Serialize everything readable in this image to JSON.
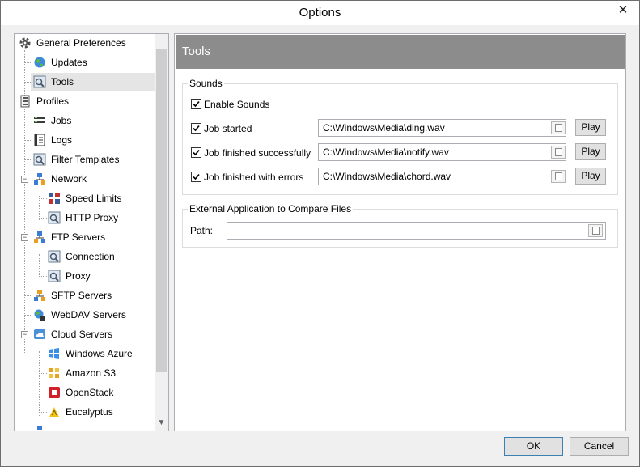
{
  "window": {
    "title": "Options",
    "close_glyph": "✕"
  },
  "tree": {
    "items": [
      {
        "label": "General Preferences",
        "icon": "gear-icon"
      },
      {
        "label": "Updates",
        "icon": "globe-icon"
      },
      {
        "label": "Tools",
        "icon": "tools-icon"
      },
      {
        "label": "Profiles",
        "icon": "profiles-icon"
      },
      {
        "label": "Jobs",
        "icon": "jobs-icon"
      },
      {
        "label": "Logs",
        "icon": "logs-icon"
      },
      {
        "label": "Filter Templates",
        "icon": "filter-icon"
      },
      {
        "label": "Network",
        "icon": "network-icon"
      },
      {
        "label": "Speed Limits",
        "icon": "speed-icon"
      },
      {
        "label": "HTTP Proxy",
        "icon": "proxy-icon"
      },
      {
        "label": "FTP Servers",
        "icon": "ftp-icon"
      },
      {
        "label": "Connection",
        "icon": "connection-icon"
      },
      {
        "label": "Proxy",
        "icon": "proxy-icon"
      },
      {
        "label": "SFTP Servers",
        "icon": "sftp-icon"
      },
      {
        "label": "WebDAV Servers",
        "icon": "webdav-icon"
      },
      {
        "label": "Cloud Servers",
        "icon": "cloud-icon"
      },
      {
        "label": "Windows Azure",
        "icon": "azure-icon"
      },
      {
        "label": "Amazon S3",
        "icon": "amazon-icon"
      },
      {
        "label": "OpenStack",
        "icon": "openstack-icon"
      },
      {
        "label": "Eucalyptus",
        "icon": "eucalyptus-icon"
      }
    ],
    "collapse_glyph": "−",
    "scroll_down": "▼"
  },
  "content": {
    "header": "Tools",
    "sounds": {
      "legend": "Sounds",
      "enable_label": "Enable Sounds",
      "rows": [
        {
          "label": "Job started",
          "path": "C:\\Windows\\Media\\ding.wav",
          "button": "Play"
        },
        {
          "label": "Job finished successfully",
          "path": "C:\\Windows\\Media\\notify.wav",
          "button": "Play"
        },
        {
          "label": "Job finished with errors",
          "path": "C:\\Windows\\Media\\chord.wav",
          "button": "Play"
        }
      ]
    },
    "external": {
      "legend": "External Application to Compare Files",
      "path_label": "Path:",
      "path_value": ""
    }
  },
  "buttons": {
    "ok": "OK",
    "cancel": "Cancel"
  }
}
